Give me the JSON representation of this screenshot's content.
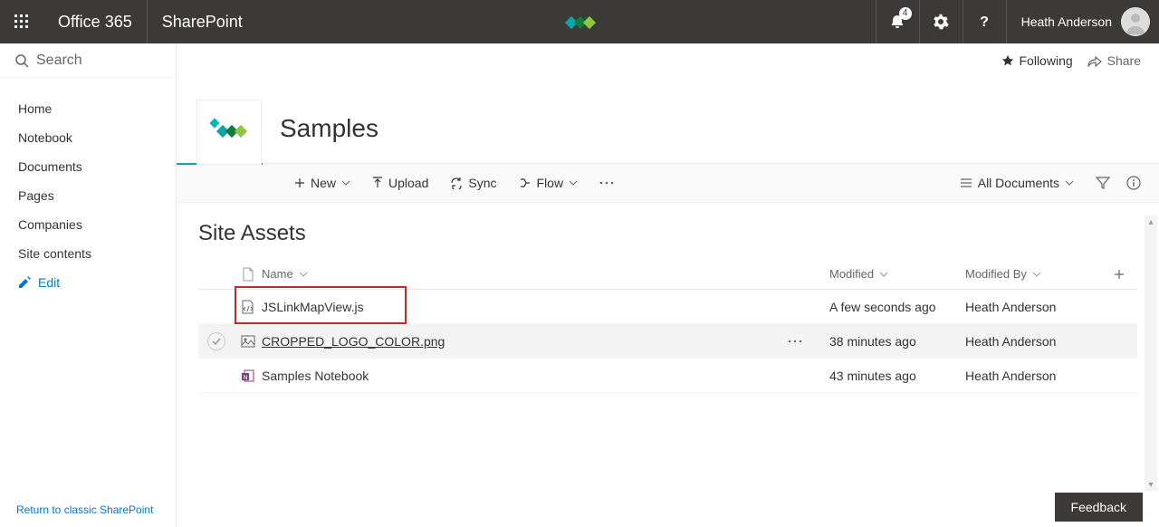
{
  "topbar": {
    "brand": "Office 365",
    "app": "SharePoint",
    "notification_count": "4",
    "username": "Heath Anderson"
  },
  "search": {
    "placeholder": "Search"
  },
  "nav": {
    "items": [
      "Home",
      "Notebook",
      "Documents",
      "Pages",
      "Companies",
      "Site contents"
    ],
    "edit_label": "Edit",
    "return_link": "Return to classic SharePoint"
  },
  "page_actions": {
    "following": "Following",
    "share": "Share"
  },
  "site": {
    "title": "Samples"
  },
  "cmdbar": {
    "new": "New",
    "upload": "Upload",
    "sync": "Sync",
    "flow": "Flow",
    "view_label": "All Documents"
  },
  "list": {
    "title": "Site Assets",
    "columns": {
      "name": "Name",
      "modified": "Modified",
      "modified_by": "Modified By"
    },
    "rows": [
      {
        "name": "JSLinkMapView.js",
        "modified": "A few seconds ago",
        "modified_by": "Heath Anderson",
        "icon": "js",
        "hover": false,
        "highlighted": true
      },
      {
        "name": "CROPPED_LOGO_COLOR.png",
        "modified": "38 minutes ago",
        "modified_by": "Heath Anderson",
        "icon": "image",
        "hover": true,
        "highlighted": false
      },
      {
        "name": "Samples Notebook",
        "modified": "43 minutes ago",
        "modified_by": "Heath Anderson",
        "icon": "onenote",
        "hover": false,
        "highlighted": false
      }
    ]
  },
  "feedback": {
    "label": "Feedback"
  }
}
